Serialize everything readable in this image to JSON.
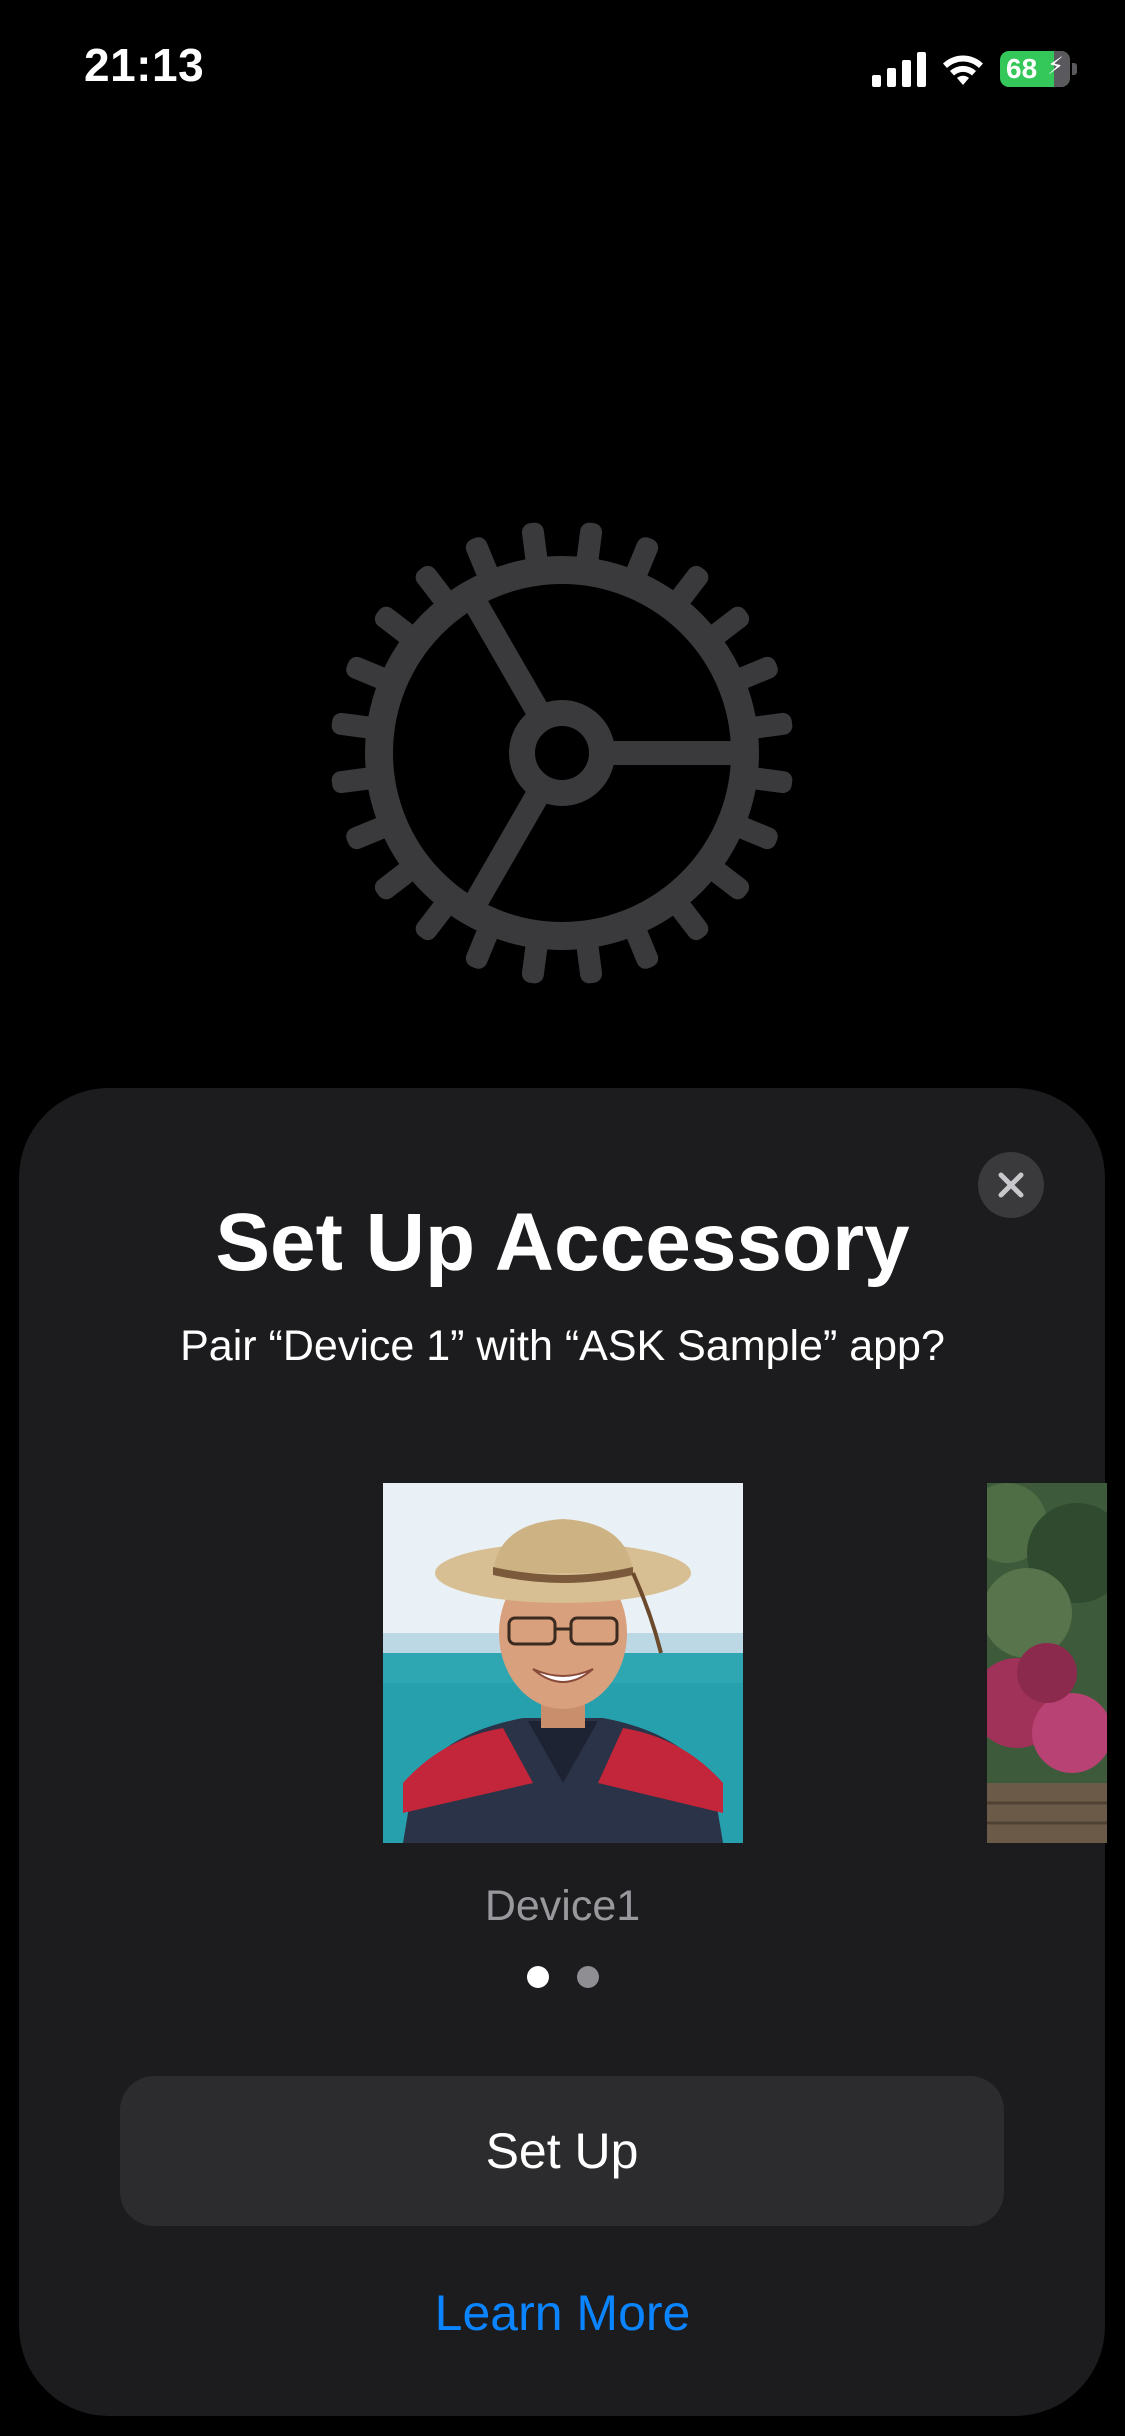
{
  "status_bar": {
    "time": "21:13",
    "battery_level": "68",
    "icons": [
      "cellular-signal-icon",
      "wifi-icon",
      "battery-charging-icon"
    ]
  },
  "hero": {
    "icon": "gear-icon"
  },
  "sheet": {
    "title": "Set Up Accessory",
    "subtitle": "Pair “Device 1” with “ASK Sample” app?",
    "close_icon": "close-icon",
    "carousel": {
      "selected_device_name": "Device1",
      "page_count": 2,
      "active_page": 1
    },
    "primary_button_label": "Set Up",
    "secondary_link_label": "Learn More"
  },
  "colors": {
    "background": "#000000",
    "sheet": "#1c1c1e",
    "gear": "#3a3a3c",
    "button": "#2c2c2e",
    "link": "#0a84ff",
    "battery": "#34c759",
    "secondary_text": "#98989d"
  }
}
